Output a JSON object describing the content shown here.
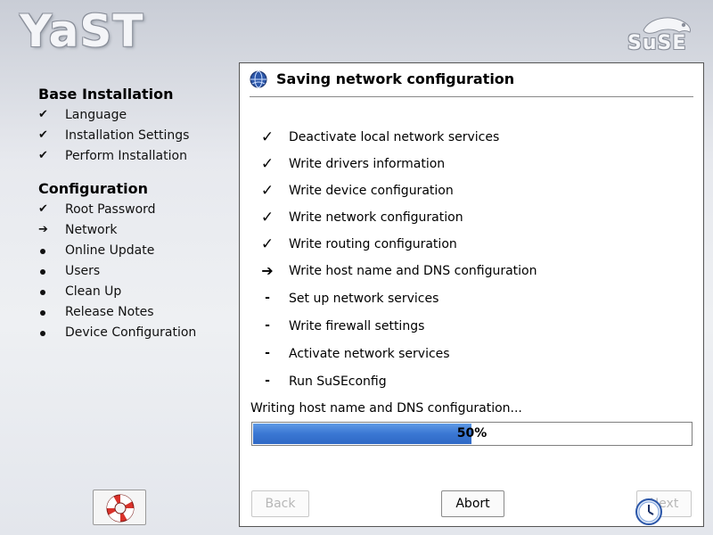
{
  "header": {
    "logo_text": "YaST",
    "brand_text": "SuSE"
  },
  "sidebar": {
    "sections": [
      {
        "title": "Base Installation",
        "steps": [
          {
            "label": "Language",
            "status": "done"
          },
          {
            "label": "Installation Settings",
            "status": "done"
          },
          {
            "label": "Perform Installation",
            "status": "done"
          }
        ]
      },
      {
        "title": "Configuration",
        "steps": [
          {
            "label": "Root Password",
            "status": "done"
          },
          {
            "label": "Network",
            "status": "current"
          },
          {
            "label": "Online Update",
            "status": "pending"
          },
          {
            "label": "Users",
            "status": "pending"
          },
          {
            "label": "Clean Up",
            "status": "pending"
          },
          {
            "label": "Release Notes",
            "status": "pending"
          },
          {
            "label": "Device Configuration",
            "status": "pending"
          }
        ]
      }
    ],
    "help_icon": "lifebuoy-icon"
  },
  "main": {
    "title": "Saving network configuration",
    "title_icon": "globe-icon",
    "items": [
      {
        "label": "Deactivate local network services",
        "status": "done"
      },
      {
        "label": "Write drivers information",
        "status": "done"
      },
      {
        "label": "Write device configuration",
        "status": "done"
      },
      {
        "label": "Write network configuration",
        "status": "done"
      },
      {
        "label": "Write routing configuration",
        "status": "done"
      },
      {
        "label": "Write host name and DNS configuration",
        "status": "current"
      },
      {
        "label": "Set up network services",
        "status": "pending"
      },
      {
        "label": "Write firewall settings",
        "status": "pending"
      },
      {
        "label": "Activate network services",
        "status": "pending"
      },
      {
        "label": "Run SuSEconfig",
        "status": "pending"
      }
    ],
    "status_text": "Writing host name and DNS configuration...",
    "progress": {
      "percent": 50,
      "label": "50%"
    },
    "buttons": {
      "back": "Back",
      "abort": "Abort",
      "next": "Next"
    }
  },
  "colors": {
    "progress_fill": "#3a77d3",
    "panel_bg": "#ffffff"
  }
}
